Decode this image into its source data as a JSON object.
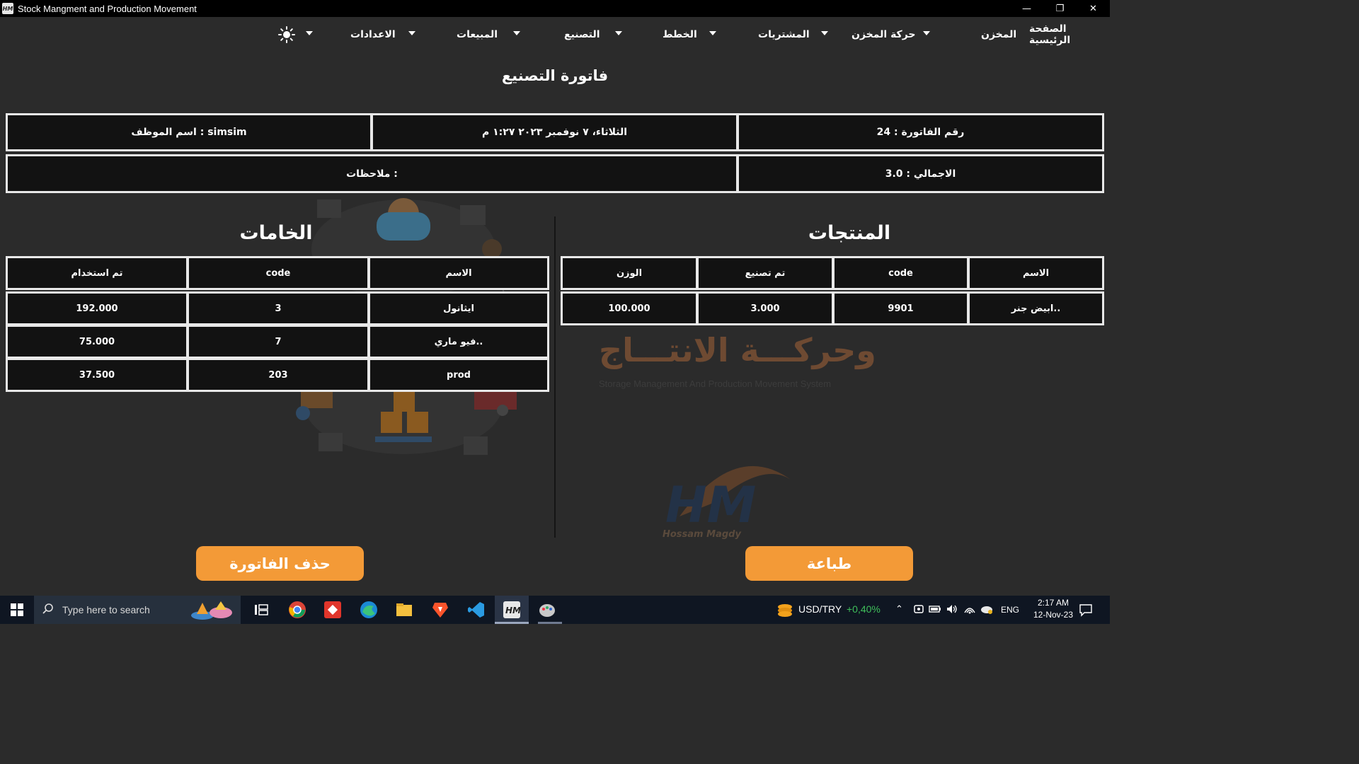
{
  "window": {
    "title": "Stock Mangment and Production Movement",
    "icon_text": "HM",
    "controls": [
      "—",
      "❐",
      "✕"
    ]
  },
  "menu": {
    "items": [
      "الصفحة الرئيسية",
      "المخزن",
      "حركة المخزن",
      "المشتريات",
      "الخطط",
      "التصنيع",
      "المبيعات",
      "الاعدادات"
    ]
  },
  "page": {
    "title": "فاتورة التصنيع"
  },
  "invoice": {
    "number": "رقم الفاتورة : 24",
    "date": "الثلاثاء، ٧ نوفمبر ٢٠٢٣   ١:٢٧ م",
    "employee": "اسم الموظف : simsim",
    "total": "الاجمالي : 3.0",
    "notes": "ملاحظات :"
  },
  "products": {
    "title": "المنتجات",
    "columns": [
      "الاسم",
      "code",
      "تم تصنيع",
      "الوزن"
    ],
    "rows": [
      [
        "ابيض جنر..",
        "9901",
        "3.000",
        "100.000"
      ]
    ]
  },
  "materials": {
    "title": "الخامات",
    "columns": [
      "الاسم",
      "code",
      "تم استخدام"
    ],
    "rows": [
      [
        "ايثانول",
        "3",
        "192.000"
      ],
      [
        "فيو ماري..",
        "7",
        "75.000"
      ],
      [
        "prod",
        "203",
        "37.500"
      ]
    ]
  },
  "watermark": {
    "title": "وحركـــة الانتـــاج",
    "subtitle": "Storage Management And Production Movement System",
    "author": "Hossam Magdy",
    "logo_text": "HM"
  },
  "buttons": {
    "print": "طباعة",
    "delete": "حذف الفاتورة"
  },
  "taskbar": {
    "search_placeholder": "Type here to search",
    "ticker": "USD/TRY",
    "ticker_change": "+0,40%",
    "lang": "ENG",
    "time": "2:17 AM",
    "date": "12-Nov-23"
  },
  "colors": {
    "accent": "#f39a37",
    "background": "#2b2b2b",
    "cell": "#121212",
    "ticker_up": "#3fbf5a"
  }
}
